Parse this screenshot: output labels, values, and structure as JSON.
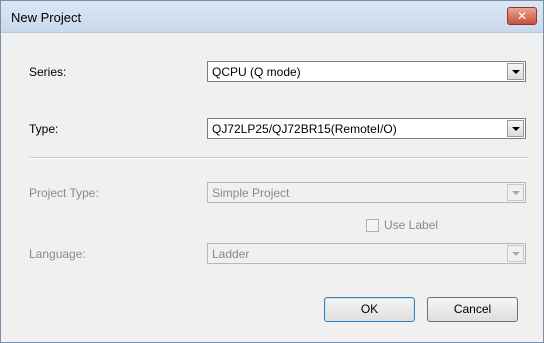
{
  "window": {
    "title": "New Project",
    "close_label": "✕"
  },
  "series": {
    "label": "Series:",
    "value": "QCPU (Q mode)"
  },
  "type": {
    "label": "Type:",
    "value": "QJ72LP25/QJ72BR15(RemoteI/O)"
  },
  "project_type": {
    "label": "Project Type:",
    "value": "Simple Project"
  },
  "use_label": {
    "label": "Use Label",
    "checked": false
  },
  "language": {
    "label": "Language:",
    "value": "Ladder"
  },
  "buttons": {
    "ok": "OK",
    "cancel": "Cancel"
  }
}
